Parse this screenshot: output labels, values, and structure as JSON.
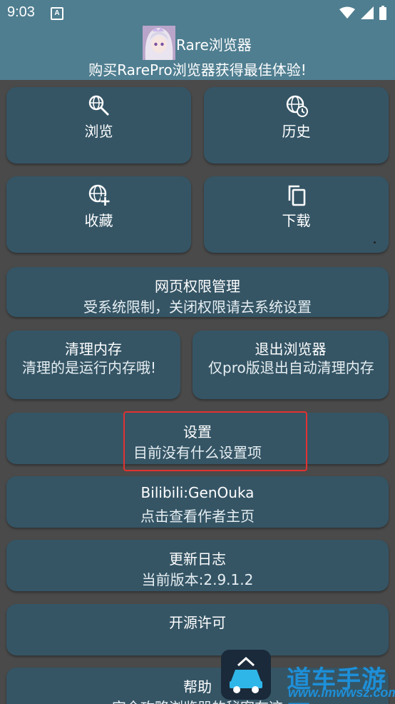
{
  "status_bar": {
    "time": "9:03",
    "notification_letter": "A"
  },
  "app_bar": {
    "title": "Rare浏览器"
  },
  "banner": {
    "text": "购买RarePro浏览器获得最佳体验!"
  },
  "grid_buttons": [
    {
      "label": "浏览",
      "icon": "search-globe-icon"
    },
    {
      "label": "历史",
      "icon": "globe-history-icon"
    },
    {
      "label": "收藏",
      "icon": "globe-add-icon"
    },
    {
      "label": "下载",
      "icon": "copy-icon"
    }
  ],
  "permissions": {
    "title": "网页权限管理",
    "subtitle": "受系统限制，关闭权限请去系统设置"
  },
  "clear_memory": {
    "title": "清理内存",
    "subtitle": "清理的是运行内存哦!"
  },
  "exit_browser": {
    "title": "退出浏览器",
    "subtitle": "仅pro版退出自动清理内存"
  },
  "settings": {
    "title": "设置",
    "subtitle": "目前没有什么设置项"
  },
  "author": {
    "title": "Bilibili:GenOuka",
    "subtitle": "点击查看作者主页"
  },
  "changelog": {
    "title": "更新日志",
    "subtitle": "当前版本:2.9.1.2"
  },
  "license": {
    "title": "开源许可"
  },
  "help": {
    "title": "帮助",
    "subtitle": "完全攻略浏览器的秘密在这"
  },
  "watermark": {
    "text": "道车手游网",
    "url": "www.lmwwsz.com"
  },
  "colors": {
    "appbar": "#4f7e90",
    "card": "#355565",
    "background": "#4a4a4a",
    "highlight": "#e23131"
  }
}
